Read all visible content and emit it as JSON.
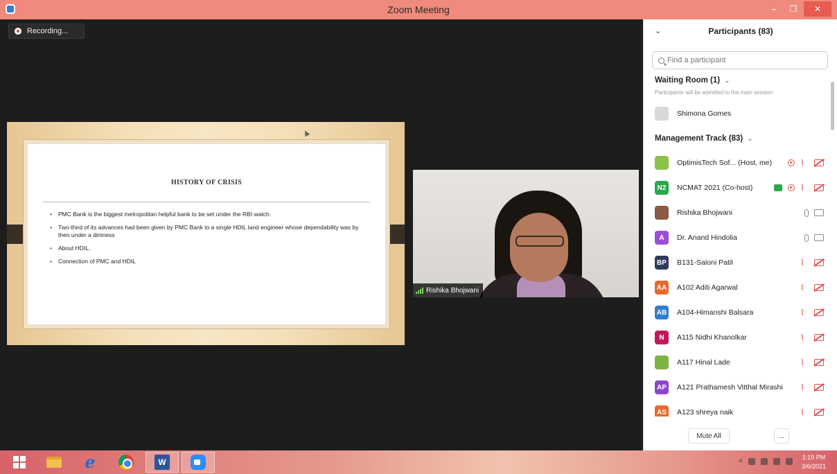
{
  "window": {
    "title": "Zoom Meeting",
    "minimize": "–",
    "maximize": "❐",
    "close": "✕"
  },
  "recording": {
    "label": "Recording..."
  },
  "slide": {
    "title": "HISTORY OF CRISIS",
    "bullets": [
      "PMC Bank is the biggest metropolitan helpful bank to be set under the RBI watch.",
      "Two-third of its advances had been given by PMC Bank to a single HDIL land engineer whose dependability was by then under a dimness",
      "About HDIL.",
      "Connection of PMC and HDIL"
    ]
  },
  "video": {
    "name": "Rishika Bhojwani"
  },
  "participants_panel": {
    "title": "Participants (83)",
    "search_placeholder": "Find a participant",
    "waiting_room": {
      "title": "Waiting Room (1)",
      "subtitle": "Participants will be admitted to the main session",
      "person": "Shimona Gomes"
    },
    "track_title": "Management Track (83)",
    "participants": [
      {
        "initials": "",
        "name": "OptimisTech Sof...  (Host, me)",
        "color": "#8bc34a",
        "status": "rec-muted"
      },
      {
        "initials": "N2",
        "name": "NCMAT 2021 (Co-host)",
        "color": "#2aa84a",
        "status": "cohost-muted"
      },
      {
        "initials": "",
        "name": "Rishika Bhojwani",
        "color": "#8a5a44",
        "status": "active"
      },
      {
        "initials": "A",
        "name": "Dr. Anand Hindolia",
        "color": "#9c4fd6",
        "status": "active"
      },
      {
        "initials": "BP",
        "name": "B131-Saloni Patil",
        "color": "#2f3a5c",
        "status": "muted"
      },
      {
        "initials": "AA",
        "name": "A102 Aditi Agarwal",
        "color": "#e86a2a",
        "status": "muted"
      },
      {
        "initials": "AB",
        "name": "A104-Himanshi Balsara",
        "color": "#2f7fcf",
        "status": "muted"
      },
      {
        "initials": "N",
        "name": "A115 Nidhi Khanolkar",
        "color": "#c2185b",
        "status": "muted"
      },
      {
        "initials": "",
        "name": "A117 Hinal Lade",
        "color": "#7cb342",
        "status": "muted"
      },
      {
        "initials": "AP",
        "name": "A121 Prathamesh Vitthal Mirashi",
        "color": "#8e44c8",
        "status": "muted"
      },
      {
        "initials": "AS",
        "name": "A123 shreya naik",
        "color": "#e86a2a",
        "status": "muted"
      }
    ],
    "mute_all": "Mute All",
    "more": "..."
  },
  "taskbar": {
    "apps": [
      "windows-start",
      "file-explorer",
      "internet-explorer",
      "chrome",
      "word",
      "zoom"
    ],
    "word_label": "W",
    "ie_label": "e",
    "time": "1:19 PM",
    "date": "3/6/2021"
  }
}
